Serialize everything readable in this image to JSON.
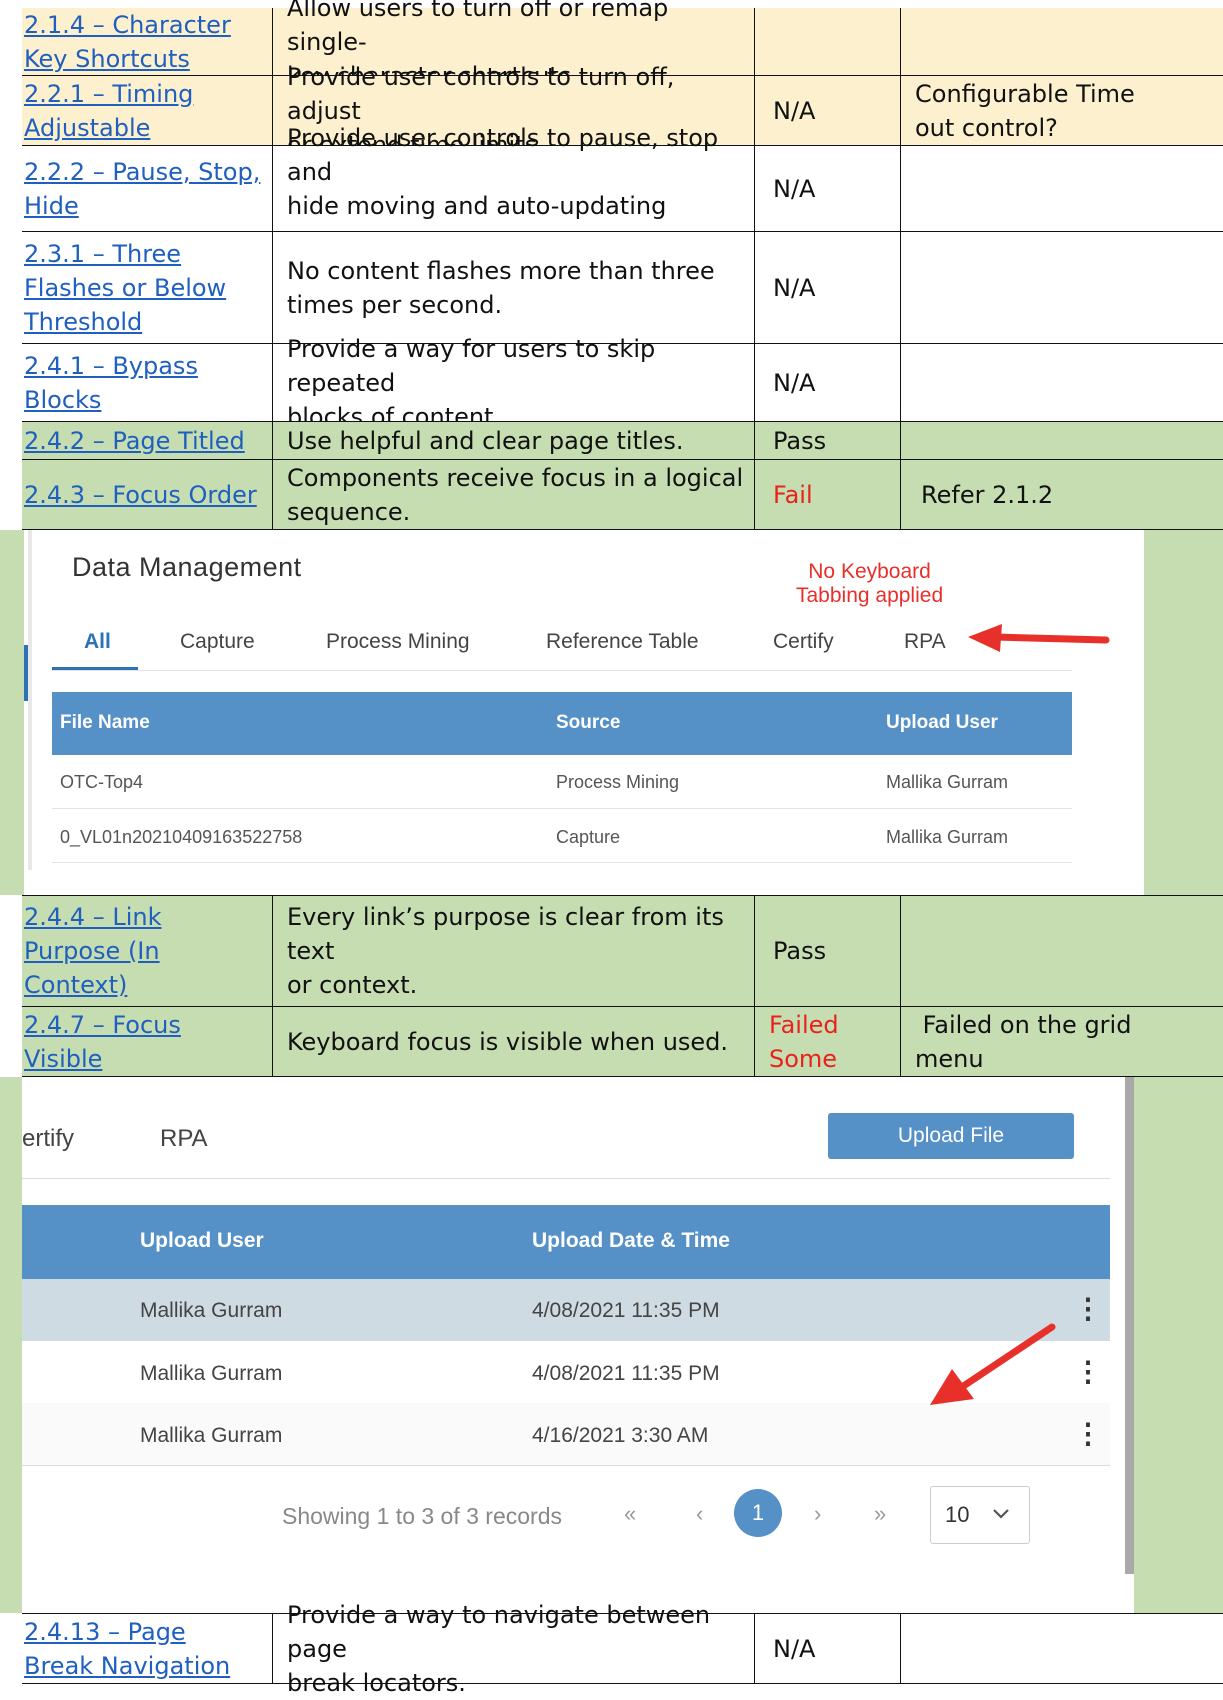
{
  "rows_top": [
    {
      "criterion": "2.1.4 – Character Key Shortcuts",
      "criterion_lines": [
        "2.1.4 – Character",
        "Key Shortcuts"
      ],
      "description": "Allow users to turn off or remap single-key character shortcuts.",
      "description_lines": [
        "Allow users to turn off or remap single-",
        "key character shortcuts."
      ],
      "result": "",
      "notes": ""
    },
    {
      "criterion_lines": [
        "2.2.1 – Timing",
        "Adjustable"
      ],
      "description_lines": [
        "Provide user controls to turn off, adjust",
        "or extend time limits."
      ],
      "result": "N/A",
      "notes_lines": [
        "Configurable Time",
        "out control?"
      ]
    },
    {
      "criterion_lines": [
        "2.2.2 – Pause, Stop,",
        "Hide"
      ],
      "description_lines": [
        "Provide user controls to pause, stop and",
        "hide moving and auto-updating content."
      ],
      "result": "N/A",
      "notes_lines": []
    },
    {
      "criterion_lines": [
        "2.3.1 – Three",
        "Flashes or Below",
        "Threshold"
      ],
      "description_lines": [
        "No content flashes more than three",
        "times per second."
      ],
      "result": "N/A",
      "notes_lines": []
    },
    {
      "criterion_lines": [
        "2.4.1 – Bypass",
        "Blocks"
      ],
      "description_lines": [
        "Provide a way for users to skip repeated",
        "blocks of content."
      ],
      "result": "N/A",
      "notes_lines": []
    },
    {
      "criterion_lines": [
        "2.4.2 – Page Titled"
      ],
      "description_lines": [
        "Use helpful and clear page titles."
      ],
      "result": "Pass",
      "notes_lines": []
    },
    {
      "criterion_lines": [
        "2.4.3 – Focus Order"
      ],
      "description_lines": [
        "Components receive focus in a logical",
        "sequence."
      ],
      "result": "Fail",
      "notes_lines": [
        "Refer 2.1.2"
      ]
    }
  ],
  "screenshot1": {
    "title": "Data Management",
    "annotation_lines": [
      "No Keyboard",
      "Tabbing applied"
    ],
    "tabs": [
      "All",
      "Capture",
      "Process Mining",
      "Reference Table",
      "Certify",
      "RPA"
    ],
    "columns": [
      "File Name",
      "Source",
      "Upload User"
    ],
    "rows": [
      [
        "OTC-Top4",
        "Process Mining",
        "Mallika Gurram"
      ],
      [
        "0_VL01n20210409163522758",
        "Capture",
        "Mallika Gurram"
      ]
    ]
  },
  "rows_mid": [
    {
      "criterion_lines": [
        "2.4.4 – Link",
        "Purpose (In",
        "Context)"
      ],
      "description_lines": [
        "Every link’s purpose is clear from its text",
        "or context."
      ],
      "result_lines": [
        "Pass"
      ],
      "notes_lines": []
    },
    {
      "criterion_lines": [
        "2.4.7 – Focus",
        "Visible"
      ],
      "description_lines": [
        "Keyboard focus is visible when used."
      ],
      "result_lines": [
        "Failed",
        "Some"
      ],
      "notes_lines": [
        " Failed on the grid",
        "menu"
      ]
    }
  ],
  "screenshot2": {
    "tabs": [
      "ertify",
      "RPA"
    ],
    "upload_button": "Upload File",
    "columns": [
      "Upload User",
      "Upload Date & Time"
    ],
    "rows": [
      [
        "Mallika Gurram",
        "4/08/2021 11:35 PM"
      ],
      [
        "Mallika Gurram",
        "4/08/2021 11:35 PM"
      ],
      [
        "Mallika Gurram",
        "4/16/2021 3:30 AM"
      ]
    ],
    "pagination_text": "Showing 1 to 3 of 3 records",
    "first_icon": "«",
    "prev_icon": "‹",
    "current_page": "1",
    "next_icon": "›",
    "last_icon": "»",
    "page_size": "10",
    "kebab_icon": "⋮"
  },
  "rows_bottom": [
    {
      "criterion_lines": [
        "2.4.13 – Page",
        "Break Navigation"
      ],
      "description_lines": [
        "Provide a way to navigate between page",
        "break locators."
      ],
      "result": "N/A",
      "notes_lines": []
    }
  ],
  "colors": {
    "yellow": "#fdf0cf",
    "green": "#c6ddb2",
    "link": "#1f5fbf",
    "fail_red": "#e8231b",
    "grid_blue": "#5590c7"
  }
}
